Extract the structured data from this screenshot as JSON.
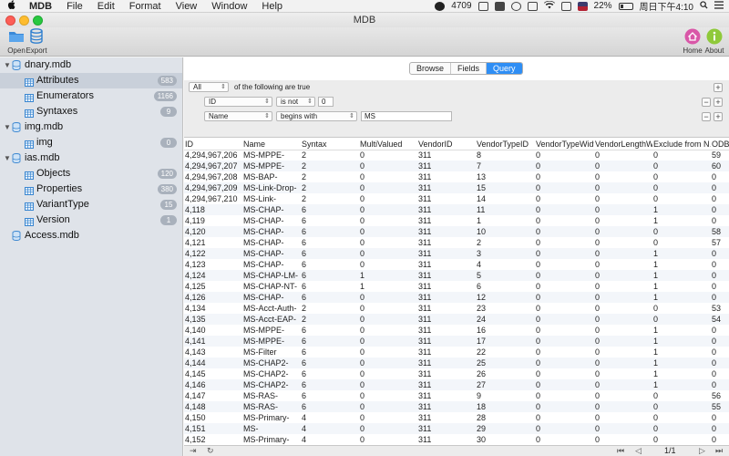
{
  "menubar": {
    "app_name": "MDB",
    "items": [
      "File",
      "Edit",
      "Format",
      "View",
      "Window",
      "Help"
    ],
    "status_count": "4709",
    "battery": "22%",
    "clock": "周日下午4:10"
  },
  "window": {
    "title": "MDB"
  },
  "toolbar": {
    "open_label": "Open",
    "export_label": "Export",
    "home_label": "Home",
    "about_label": "About"
  },
  "sidebar": {
    "databases": [
      {
        "name": "dnary.mdb",
        "tables": [
          {
            "name": "Attributes",
            "count": "583",
            "selected": true
          },
          {
            "name": "Enumerators",
            "count": "1166"
          },
          {
            "name": "Syntaxes",
            "count": "9"
          }
        ]
      },
      {
        "name": "img.mdb",
        "tables": [
          {
            "name": "img",
            "count": "0"
          }
        ]
      },
      {
        "name": "ias.mdb",
        "tables": [
          {
            "name": "Objects",
            "count": "120"
          },
          {
            "name": "Properties",
            "count": "380"
          },
          {
            "name": "VariantType",
            "count": "15"
          },
          {
            "name": "Version",
            "count": "1"
          }
        ]
      },
      {
        "name": "Access.mdb",
        "tables": []
      }
    ]
  },
  "tabs": [
    "Browse",
    "Fields",
    "Query"
  ],
  "active_tab": "Query",
  "query": {
    "match_mode": "All",
    "match_text": "of the following are true",
    "conditions": [
      {
        "field": "ID",
        "operator": "is not",
        "value": "0"
      },
      {
        "field": "Name",
        "operator": "begins with",
        "value": "MS"
      }
    ],
    "add_symbol": "+",
    "remove_symbol": "−"
  },
  "table": {
    "columns": [
      "ID",
      "Name",
      "Syntax",
      "MultiValued",
      "VendorID",
      "VendorTypeID",
      "VendorTypeWidth",
      "VendorLengthWi…",
      "Exclude from N…",
      "ODBC"
    ],
    "rows": [
      [
        "4,294,967,206",
        "MS-MPPE-",
        "2",
        "0",
        "311",
        "8",
        "0",
        "0",
        "0",
        "59"
      ],
      [
        "4,294,967,207",
        "MS-MPPE-",
        "2",
        "0",
        "311",
        "7",
        "0",
        "0",
        "0",
        "60"
      ],
      [
        "4,294,967,208",
        "MS-BAP-",
        "2",
        "0",
        "311",
        "13",
        "0",
        "0",
        "0",
        "0"
      ],
      [
        "4,294,967,209",
        "MS-Link-Drop-",
        "2",
        "0",
        "311",
        "15",
        "0",
        "0",
        "0",
        "0"
      ],
      [
        "4,294,967,210",
        "MS-Link-",
        "2",
        "0",
        "311",
        "14",
        "0",
        "0",
        "0",
        "0"
      ],
      [
        "4,118",
        "MS-CHAP-",
        "6",
        "0",
        "311",
        "11",
        "0",
        "0",
        "1",
        "0"
      ],
      [
        "4,119",
        "MS-CHAP-",
        "6",
        "0",
        "311",
        "1",
        "0",
        "0",
        "1",
        "0"
      ],
      [
        "4,120",
        "MS-CHAP-",
        "6",
        "0",
        "311",
        "10",
        "0",
        "0",
        "0",
        "58"
      ],
      [
        "4,121",
        "MS-CHAP-",
        "6",
        "0",
        "311",
        "2",
        "0",
        "0",
        "0",
        "57"
      ],
      [
        "4,122",
        "MS-CHAP-",
        "6",
        "0",
        "311",
        "3",
        "0",
        "0",
        "1",
        "0"
      ],
      [
        "4,123",
        "MS-CHAP-",
        "6",
        "0",
        "311",
        "4",
        "0",
        "0",
        "1",
        "0"
      ],
      [
        "4,124",
        "MS-CHAP-LM-",
        "6",
        "1",
        "311",
        "5",
        "0",
        "0",
        "1",
        "0"
      ],
      [
        "4,125",
        "MS-CHAP-NT-",
        "6",
        "1",
        "311",
        "6",
        "0",
        "0",
        "1",
        "0"
      ],
      [
        "4,126",
        "MS-CHAP-",
        "6",
        "0",
        "311",
        "12",
        "0",
        "0",
        "1",
        "0"
      ],
      [
        "4,134",
        "MS-Acct-Auth-",
        "2",
        "0",
        "311",
        "23",
        "0",
        "0",
        "0",
        "53"
      ],
      [
        "4,135",
        "MS-Acct-EAP-",
        "2",
        "0",
        "311",
        "24",
        "0",
        "0",
        "0",
        "54"
      ],
      [
        "4,140",
        "MS-MPPE-",
        "6",
        "0",
        "311",
        "16",
        "0",
        "0",
        "1",
        "0"
      ],
      [
        "4,141",
        "MS-MPPE-",
        "6",
        "0",
        "311",
        "17",
        "0",
        "0",
        "1",
        "0"
      ],
      [
        "4,143",
        "MS-Filter",
        "6",
        "0",
        "311",
        "22",
        "0",
        "0",
        "1",
        "0"
      ],
      [
        "4,144",
        "MS-CHAP2-",
        "6",
        "0",
        "311",
        "25",
        "0",
        "0",
        "1",
        "0"
      ],
      [
        "4,145",
        "MS-CHAP2-",
        "6",
        "0",
        "311",
        "26",
        "0",
        "0",
        "1",
        "0"
      ],
      [
        "4,146",
        "MS-CHAP2-",
        "6",
        "0",
        "311",
        "27",
        "0",
        "0",
        "1",
        "0"
      ],
      [
        "4,147",
        "MS-RAS-",
        "6",
        "0",
        "311",
        "9",
        "0",
        "0",
        "0",
        "56"
      ],
      [
        "4,148",
        "MS-RAS-",
        "6",
        "0",
        "311",
        "18",
        "0",
        "0",
        "0",
        "55"
      ],
      [
        "4,150",
        "MS-Primary-",
        "4",
        "0",
        "311",
        "28",
        "0",
        "0",
        "0",
        "0"
      ],
      [
        "4,151",
        "MS-",
        "4",
        "0",
        "311",
        "29",
        "0",
        "0",
        "0",
        "0"
      ],
      [
        "4,152",
        "MS-Primary-",
        "4",
        "0",
        "311",
        "30",
        "0",
        "0",
        "0",
        "0"
      ]
    ]
  },
  "statusbar": {
    "page": "1/1"
  },
  "colors": {
    "accent": "#2f8ef4",
    "sidebar_bg": "#dfe3e9",
    "badge": "#a9b1bc"
  }
}
